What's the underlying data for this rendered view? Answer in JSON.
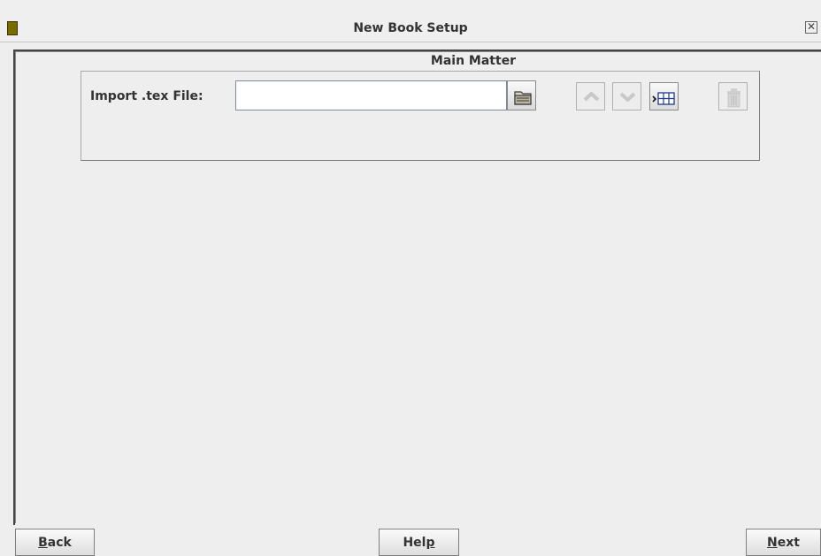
{
  "window": {
    "title": "New Book Setup",
    "close_glyph": "✕"
  },
  "section": {
    "title": "Main Matter"
  },
  "import": {
    "label": "Import .tex File:",
    "value": "",
    "placeholder": ""
  },
  "toolbar": {
    "browse_icon": "folder-icon",
    "move_up_icon": "chevron-up-icon",
    "move_down_icon": "chevron-down-icon",
    "insert_icon": "insert-table-icon",
    "delete_icon": "trash-icon"
  },
  "buttons": {
    "back": {
      "mnemonic": "B",
      "rest": "ack"
    },
    "help": {
      "before": "Hel",
      "mnemonic": "p"
    },
    "next": {
      "mnemonic": "N",
      "rest": "ext"
    }
  },
  "colors": {
    "window_bg": "#eeeeee",
    "book_icon": "#7a6b00",
    "disabled_icon": "#c8c8c8",
    "folder_icon": "#6e6a60"
  }
}
